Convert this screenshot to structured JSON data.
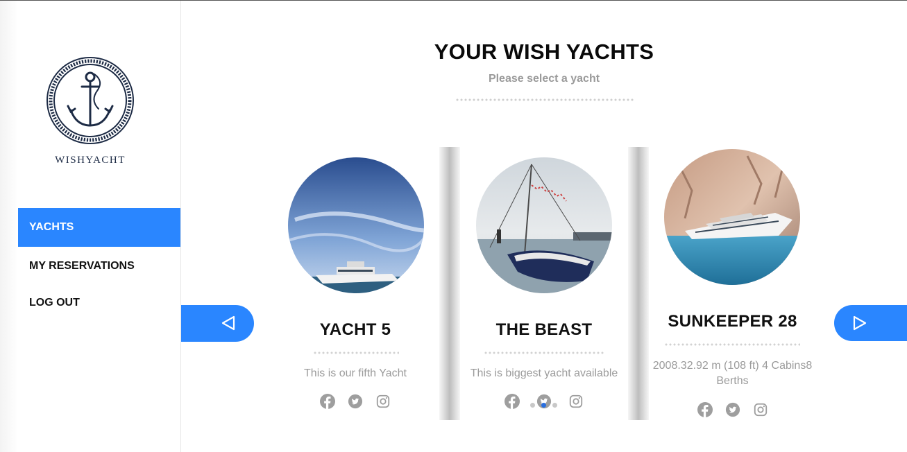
{
  "brand": {
    "name": "WISHYACHT"
  },
  "nav": [
    {
      "label": "YACHTS",
      "active": true
    },
    {
      "label": "MY RESERVATIONS",
      "active": false
    },
    {
      "label": "LOG OUT",
      "active": false
    }
  ],
  "header": {
    "title": "YOUR WISH YACHTS",
    "subtitle": "Please select a yacht"
  },
  "yachts": [
    {
      "name": "YACHT 5",
      "description": "This is our fifth Yacht"
    },
    {
      "name": "THE BEAST",
      "description": "This is biggest yacht available"
    },
    {
      "name": "SUNKEEPER 28",
      "description": "2008.32.92 m (108 ft) 4 Cabins8 Berths"
    }
  ],
  "carousel": {
    "pages": 3,
    "active_page": 2
  },
  "icons": [
    "anchor-logo",
    "facebook-icon",
    "twitter-icon",
    "instagram-icon",
    "arrow-left-icon",
    "arrow-right-icon"
  ],
  "colors": {
    "accent": "#2a86ff",
    "pager_active": "#2a6fe0",
    "muted_text": "#9b9b9b"
  }
}
